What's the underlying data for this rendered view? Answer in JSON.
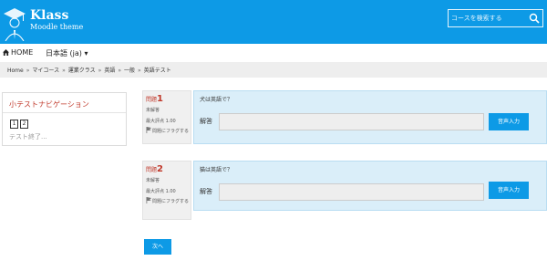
{
  "header": {
    "brand_name": "Klass",
    "brand_subtitle": "Moodle theme",
    "search_placeholder": "コースを検索する"
  },
  "nav": {
    "home": "HOME",
    "language": "日本語 (ja) ▾"
  },
  "breadcrumb": [
    "Home",
    "マイコース",
    "運業クラス",
    "英語",
    "一般",
    "英語テスト"
  ],
  "breadcrumb_sep": "»",
  "quiz_nav": {
    "title": "小テストナビゲーション",
    "buttons": [
      "1",
      "2"
    ],
    "finish": "テスト終了..."
  },
  "questions": [
    {
      "label": "問題",
      "number": "1",
      "status": "未解答",
      "max_score": "最大評点 1.00",
      "flag": "問題にフラグする",
      "text": "犬は英語で？",
      "answer_label": "解答",
      "voice_button": "音声入力"
    },
    {
      "label": "問題",
      "number": "2",
      "status": "未解答",
      "max_score": "最大評点 1.00",
      "flag": "問題にフラグする",
      "text": "猫は英語で？",
      "answer_label": "解答",
      "voice_button": "音声入力"
    }
  ],
  "next_button": "次へ",
  "colors": {
    "primary": "#0d9ae6",
    "question_bg": "#daeef9",
    "accent_red": "#c0392b"
  }
}
